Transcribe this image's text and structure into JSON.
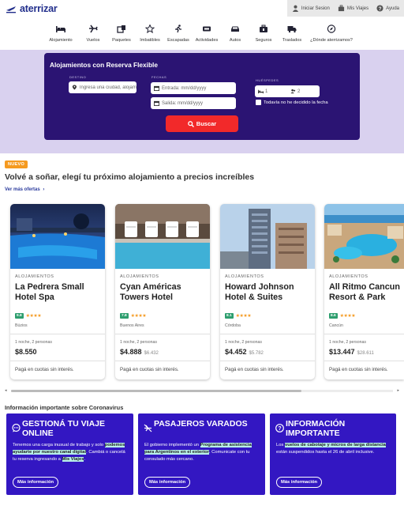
{
  "header": {
    "logo_text": "aterrizar",
    "links": [
      {
        "label": "Iniciar Sesion",
        "icon": "user-icon"
      },
      {
        "label": "Mis Viajes",
        "icon": "suitcase-icon"
      },
      {
        "label": "Ayuda",
        "icon": "help-icon"
      }
    ]
  },
  "nav": [
    {
      "label": "Alojamiento",
      "icon": "bed-icon"
    },
    {
      "label": "Vuelos",
      "icon": "plane-icon"
    },
    {
      "label": "Paquetes",
      "icon": "package-icon"
    },
    {
      "label": "Imbatibles",
      "icon": "star-icon"
    },
    {
      "label": "Escapadas",
      "icon": "runner-icon"
    },
    {
      "label": "Actividades",
      "icon": "ticket-icon"
    },
    {
      "label": "Autos",
      "icon": "car-icon"
    },
    {
      "label": "Seguros",
      "icon": "briefcase-icon"
    },
    {
      "label": "Traslados",
      "icon": "truck-icon"
    },
    {
      "label": "¿Dónde aterrizamos?",
      "icon": "compass-icon"
    }
  ],
  "search": {
    "title": "Alojamientos con Reserva Flexible",
    "destino_label": "DESTINO",
    "destino_placeholder": "Ingresá una ciudad, alojamiento o punto de interés",
    "fechas_label": "FECHAS",
    "entrada_placeholder": "Entrada: mm/dd/yyyy",
    "salida_placeholder": "Salida: mm/dd/yyyy",
    "huespedes_label": "HUÉSPEDES",
    "rooms": "1",
    "guests": "2",
    "no_date_label": "Todavía no he decidido la fecha",
    "button_label": "Buscar"
  },
  "offers": {
    "badge": "NUEVO",
    "title": "Volvé a soñar, elegí tu próximo alojamiento a precios increíbles",
    "more_link": "Ver más ofertas",
    "cards": [
      {
        "category": "ALOJAMIENTOS",
        "name_line1": "La Pedrera Small",
        "name_line2": "Hotel Spa",
        "score": "9.8",
        "stars": "★★★★",
        "city": "Búzios",
        "nights": "1 noche, 2 personas",
        "price": "$8.550",
        "old_price": ""
      },
      {
        "category": "ALOJAMIENTOS",
        "name_line1": "Cyan Américas",
        "name_line2": "Towers Hotel",
        "score": "7.8",
        "stars": "★★★★",
        "city": "Buenos Aires",
        "nights": "1 noche, 2 personas",
        "price": "$4.888",
        "old_price": "$6.432"
      },
      {
        "category": "ALOJAMIENTOS",
        "name_line1": "Howard Johnson",
        "name_line2": "Hotel & Suites",
        "score": "8.1",
        "stars": "★★★★",
        "city": "Córdoba",
        "nights": "1 noche, 2 personas",
        "price": "$4.452",
        "old_price": "$5.782"
      },
      {
        "category": "ALOJAMIENTOS",
        "name_line1": "All Ritmo Cancun",
        "name_line2": "Resort & Park",
        "score": "8.6",
        "stars": "★★★★",
        "city": "Cancún",
        "nights": "1 noche, 2 personas",
        "price": "$13.447",
        "old_price": "$28.611"
      }
    ],
    "installments": "Pagá en cuotas sin interés."
  },
  "covid": {
    "title": "Información importante sobre Coronavirus",
    "cards": [
      {
        "icon": "chat-icon",
        "title": "GESTIONÁ TU VIAJE ONLINE",
        "button": "Más información",
        "t1": "Tenemos una carga inusual de trabajo y solo ",
        "h1": "podemos ayudarte por nuestro canal digital",
        "t2": ". Cambiá o cancelá tu reserva ingresando a ",
        "h2": "Mis Viajes",
        "t3": "."
      },
      {
        "icon": "no-flight-icon",
        "title": "PASAJEROS VARADOS",
        "button": "Más información",
        "t1": "El gobierno implementó un ",
        "h1": "Programa de asistencia para Argentinos en el exterior",
        "t2": ". Comunicate con tu consulado más cercano.",
        "h2": "",
        "t3": ""
      },
      {
        "icon": "help-icon",
        "title": "INFORMACIÓN IMPORTANTE",
        "button": "Más información",
        "t1": "Los ",
        "h1": "vuelos de cabotaje y micros de larga distancia",
        "t2": " están suspendidos hasta el 26 de abril inclusive.",
        "h2": "",
        "t3": ""
      }
    ]
  },
  "colors": {
    "brand": "#2b1473",
    "accent": "#f2292a",
    "badge": "#f59a20",
    "covid": "#3317c2",
    "band": "#d9d1ef"
  }
}
